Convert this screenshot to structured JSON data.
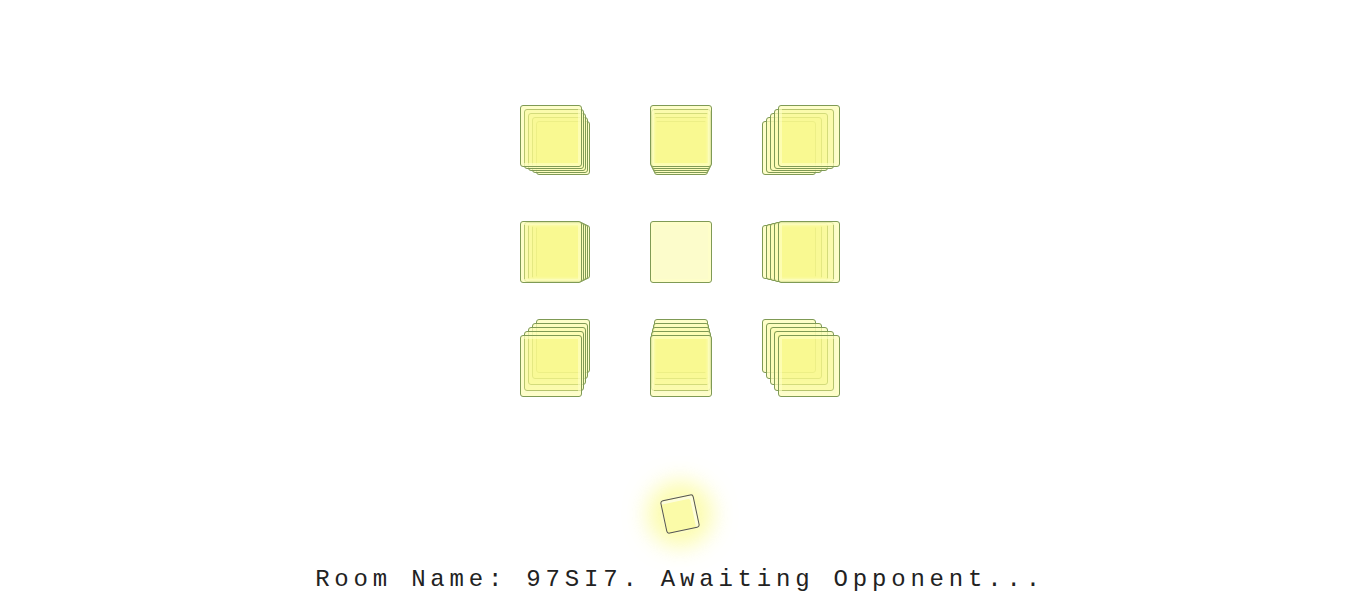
{
  "board": {
    "cells": [
      {
        "marked": false
      },
      {
        "marked": false
      },
      {
        "marked": false
      },
      {
        "marked": false
      },
      {
        "marked": false
      },
      {
        "marked": false
      },
      {
        "marked": false
      },
      {
        "marked": false
      },
      {
        "marked": false
      }
    ]
  },
  "status": "Room Name: 97SI7. Awaiting Opponent..."
}
